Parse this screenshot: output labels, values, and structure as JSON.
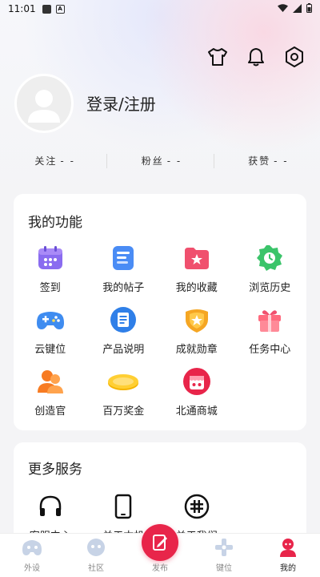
{
  "status_bar": {
    "time": "11:01"
  },
  "profile": {
    "login_label": "登录/注册"
  },
  "stats": [
    {
      "label": "关注",
      "value": "- -"
    },
    {
      "label": "粉丝",
      "value": "- -"
    },
    {
      "label": "获赞",
      "value": "- -"
    }
  ],
  "my_functions": {
    "title": "我的功能",
    "items": [
      {
        "label": "签到",
        "icon": "calendar-icon"
      },
      {
        "label": "我的帖子",
        "icon": "post-icon"
      },
      {
        "label": "我的收藏",
        "icon": "favorite-folder-icon"
      },
      {
        "label": "浏览历史",
        "icon": "history-icon"
      },
      {
        "label": "云键位",
        "icon": "gamepad-icon"
      },
      {
        "label": "产品说明",
        "icon": "document-icon"
      },
      {
        "label": "成就勋章",
        "icon": "medal-icon"
      },
      {
        "label": "任务中心",
        "icon": "gift-icon"
      },
      {
        "label": "创造官",
        "icon": "creator-icon"
      },
      {
        "label": "百万奖金",
        "icon": "coin-icon"
      },
      {
        "label": "北通商城",
        "icon": "shop-icon"
      }
    ]
  },
  "more_services": {
    "title": "更多服务",
    "items": [
      {
        "label": "客服中心",
        "icon": "headset-icon"
      },
      {
        "label": "关于本机",
        "icon": "phone-icon"
      },
      {
        "label": "关于我们",
        "icon": "about-icon"
      }
    ]
  },
  "tabs": [
    {
      "label": "外设",
      "icon": "peripheral-icon"
    },
    {
      "label": "社区",
      "icon": "community-icon"
    },
    {
      "label": "发布",
      "icon": "publish-icon"
    },
    {
      "label": "键位",
      "icon": "keymap-icon"
    },
    {
      "label": "我的",
      "icon": "profile-icon"
    }
  ],
  "colors": {
    "accent": "#e8254a",
    "card_bg": "#ffffff",
    "page_bg": "#f4f4f6"
  }
}
